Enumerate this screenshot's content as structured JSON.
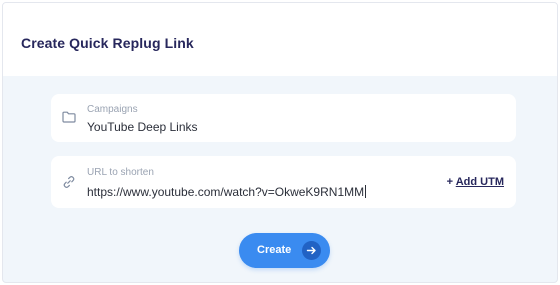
{
  "header": {
    "title": "Create Quick Replug Link"
  },
  "campaign_field": {
    "label": "Campaigns",
    "value": "YouTube Deep Links",
    "icon": "folder-icon"
  },
  "url_field": {
    "label": "URL to shorten",
    "value": "https://www.youtube.com/watch?v=OkweK9RN1MM",
    "icon": "link-icon"
  },
  "add_utm": {
    "prefix": "+ ",
    "label": "Add UTM"
  },
  "create_button": {
    "label": "Create",
    "icon": "arrow-right-icon"
  },
  "colors": {
    "title": "#27275c",
    "primary": "#3a8bf0",
    "primary_dark": "#2162c4",
    "background": "#f1f6fb"
  }
}
